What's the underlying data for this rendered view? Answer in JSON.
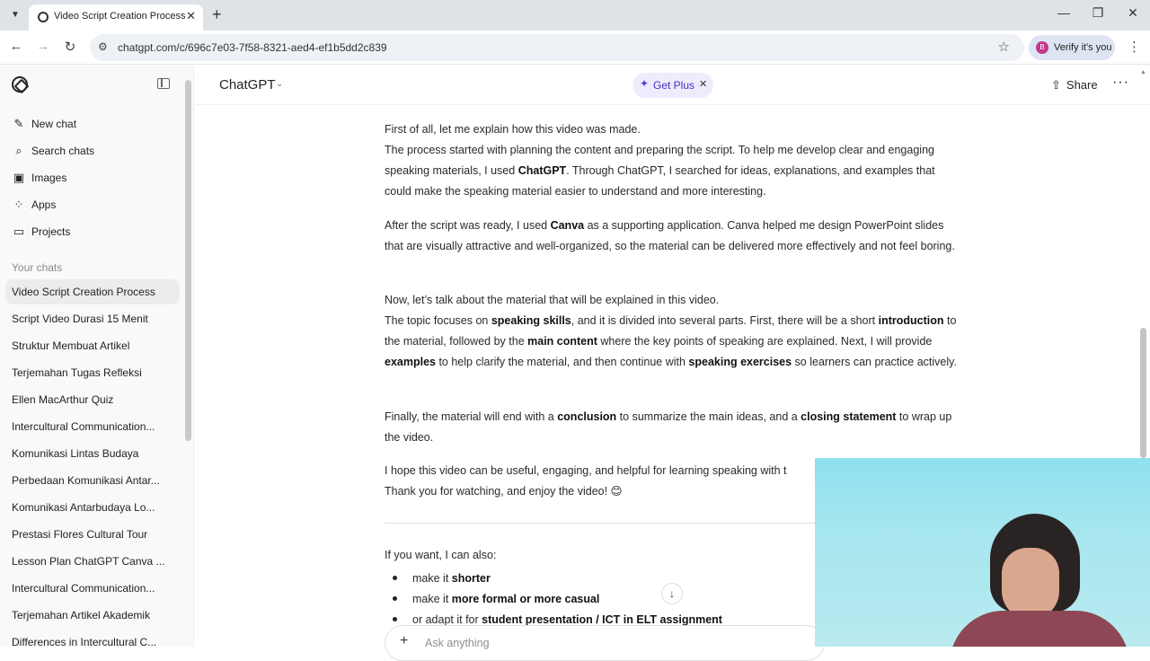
{
  "browser": {
    "tab_title": "Video Script Creation Process",
    "url": "chatgpt.com/c/696c7e03-7f58-8321-aed4-ef1b5dd2c839",
    "profile_initial": "B",
    "profile_label": "Verify it's you"
  },
  "sidebar": {
    "nav": [
      {
        "icon": "new-chat-icon",
        "label": "New chat"
      },
      {
        "icon": "search-icon",
        "label": "Search chats"
      },
      {
        "icon": "images-icon",
        "label": "Images"
      },
      {
        "icon": "apps-icon",
        "label": "Apps"
      },
      {
        "icon": "projects-icon",
        "label": "Projects"
      }
    ],
    "section_label": "Your chats",
    "chats": [
      "Video Script Creation Process",
      "Script Video Durasi 15 Menit",
      "Struktur Membuat Artikel",
      "Terjemahan Tugas Refleksi",
      "Ellen MacArthur Quiz",
      "Intercultural Communication...",
      "Komunikasi Lintas Budaya",
      "Perbedaan Komunikasi Antar...",
      "Komunikasi Antarbudaya Lo...",
      "Prestasi Flores Cultural Tour",
      "Lesson Plan ChatGPT Canva ...",
      "Intercultural Communication...",
      "Terjemahan Artikel Akademik",
      "Differences in Intercultural C..."
    ]
  },
  "header": {
    "model": "ChatGPT",
    "get_plus": "Get Plus",
    "share": "Share"
  },
  "message": {
    "p1_line1": "First of all, let me explain how this video was made.",
    "p1_a": "The process started with planning the content and preparing the script. To help me develop clear and engaging speaking materials, I used ",
    "p1_b": "ChatGPT",
    "p1_c": ". Through ChatGPT, I searched for ideas, explanations, and examples that could make the speaking material easier to understand and more interesting.",
    "p2_a": "After the script was ready, I used ",
    "p2_b": "Canva",
    "p2_c": " as a supporting application. Canva helped me design PowerPoint slides that are visually attractive and well-organized, so the material can be delivered more effectively and not feel boring.",
    "p3_line1": "Now, let’s talk about the material that will be explained in this video.",
    "p3_a": "The topic focuses on ",
    "p3_b": "speaking skills",
    "p3_c": ", and it is divided into several parts. First, there will be a short ",
    "p3_d": "introduction",
    "p3_e": " to the material, followed by the ",
    "p3_f": "main content",
    "p3_g": " where the key points of speaking are explained. Next, I will provide ",
    "p3_h": "examples",
    "p3_i": " to help clarify the material, and then continue with ",
    "p3_j": "speaking exercises",
    "p3_k": " so learners can practice actively.",
    "p4_a": "Finally, the material will end with a ",
    "p4_b": "conclusion",
    "p4_c": " to summarize the main ideas, and a ",
    "p4_d": "closing statement",
    "p4_e": " to wrap up the video.",
    "p5_line1": "I hope this video can be useful, engaging, and helpful for learning speaking with t",
    "p5_line2": "Thank you for watching, and enjoy the video! 😊",
    "followup_intro": "If you want, I can also:",
    "bullets": [
      {
        "pre": "make it ",
        "bold": "shorter",
        "post": ""
      },
      {
        "pre": "make it ",
        "bold": "more formal or more casual",
        "post": ""
      },
      {
        "pre": "or adapt it for ",
        "bold": "student presentation / ICT in ELT assignment",
        "post": ""
      }
    ]
  },
  "composer": {
    "placeholder": "Ask anything"
  }
}
